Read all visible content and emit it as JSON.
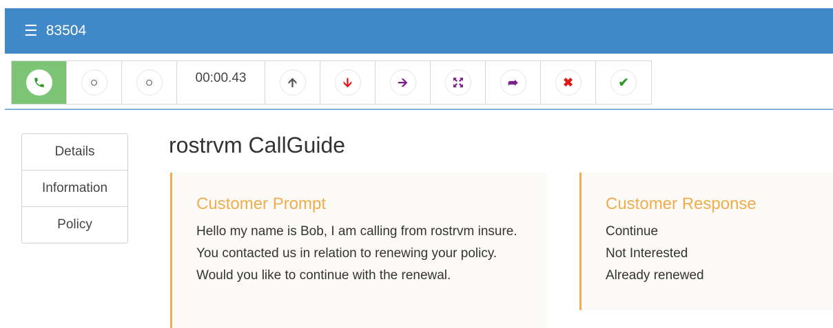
{
  "header": {
    "menu_icon": "hamburger-icon",
    "title": "83504"
  },
  "toolbar": {
    "buttons": [
      {
        "icon": "phone-icon",
        "color": "#2e9a2a"
      },
      {
        "icon": "record-off-icon",
        "color": "#222222"
      },
      {
        "icon": "record-off-icon",
        "color": "#222222"
      },
      {
        "timer": "00:00.43"
      },
      {
        "icon": "arrow-up-icon",
        "color": "#555555"
      },
      {
        "icon": "arrow-down-icon",
        "color": "#e01818"
      },
      {
        "icon": "arrow-right-icon",
        "color": "#7a1f8a"
      },
      {
        "icon": "expand-icon",
        "color": "#7a1f8a"
      },
      {
        "icon": "forward-icon",
        "color": "#7a1f8a"
      },
      {
        "icon": "close-icon",
        "color": "#e01818"
      },
      {
        "icon": "check-icon",
        "color": "#2e9a2a"
      }
    ]
  },
  "sidebar": {
    "items": [
      {
        "label": "Details"
      },
      {
        "label": "Information"
      },
      {
        "label": "Policy"
      }
    ]
  },
  "main": {
    "title": "rostrvm CallGuide",
    "prompt": {
      "heading": "Customer Prompt",
      "text": "Hello my name is Bob, I am calling from rostrvm insure. You contacted us in relation to renewing your policy. Would you like to continue with the renewal."
    },
    "response": {
      "heading": "Customer Response",
      "items": [
        {
          "label": "Continue"
        },
        {
          "label": "Not Interested"
        },
        {
          "label": "Already renewed"
        }
      ]
    }
  },
  "colors": {
    "header_bg": "#4089c9",
    "call_active_bg": "#7cc576",
    "accent_orange": "#f0ad4e",
    "panel_bg": "#fcfaf6"
  }
}
